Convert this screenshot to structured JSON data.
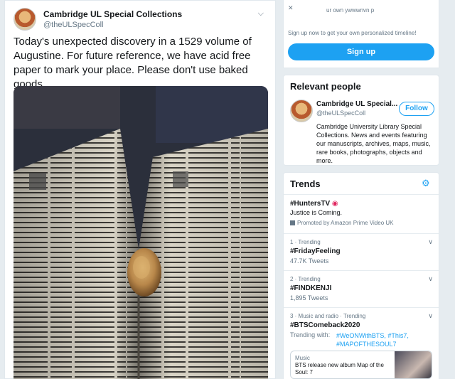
{
  "tweet": {
    "author_name": "Cambridge UL Special Collections",
    "author_handle": "@theULSpecColl",
    "text": "Today's unexpected discovery in a 1529 volume of Augustine. For future reference, we have acid free paper to mark your place. Please don't use baked goods."
  },
  "signup": {
    "top_text": "ur own      ywwwnvn p",
    "subtitle": "Sign up now to get your own personalized timeline!",
    "button_label": "Sign up"
  },
  "relevant": {
    "title": "Relevant people",
    "name": "Cambridge UL Special...",
    "handle": "@theULSpecColl",
    "follow_label": "Follow",
    "bio": "Cambridge University Library Special Collections. News and events featuring our manuscripts, archives, maps, music, rare books, photographs, objects and more."
  },
  "trends": {
    "title": "Trends",
    "items": [
      {
        "meta": "",
        "name": "#HuntersTV",
        "sub": "Justice is Coming.",
        "promo": "Promoted by Amazon Prime Video UK"
      },
      {
        "meta": "1 · Trending",
        "name": "#FridayFeeling",
        "sub": "47.7K Tweets"
      },
      {
        "meta": "2 · Trending",
        "name": "#FINDKENJI",
        "sub": "1,895 Tweets"
      },
      {
        "meta": "3 · Music and radio · Trending",
        "name": "#BTSComeback2020",
        "sub": "Trending with:",
        "links": "#WeONWithBTS, #This7, #MAPOFTHESOUL7"
      }
    ],
    "mini_card": {
      "label": "Music",
      "text": "BTS release new album Map of the Soul: 7"
    }
  },
  "colors": {
    "accent": "#1da1f2",
    "text": "#14171a",
    "muted": "#657786",
    "background": "#e6ecf0"
  }
}
